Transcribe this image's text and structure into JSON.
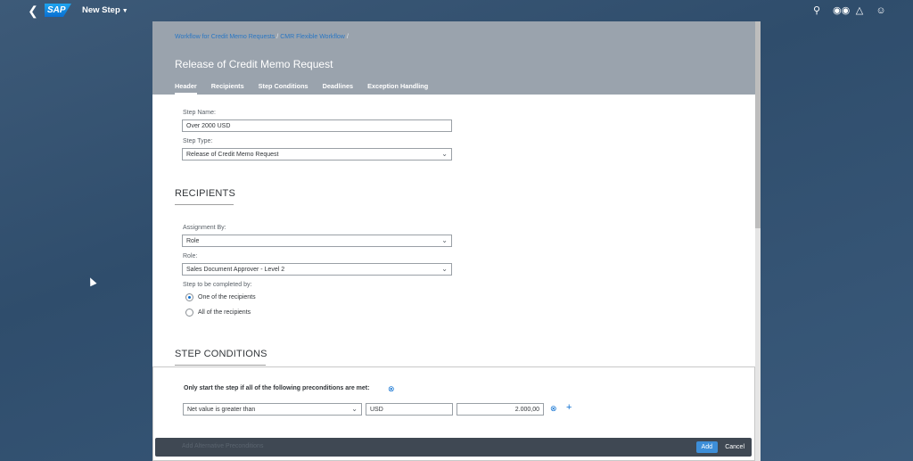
{
  "shell": {
    "app_title": "New Step",
    "logo_text": "SAP",
    "icons": [
      "search-icon",
      "binoculars-icon",
      "bell-icon",
      "user-icon"
    ]
  },
  "header": {
    "breadcrumb": [
      "Workflow for Credit Memo Requests",
      "CMR Flexible Workflow"
    ],
    "breadcrumb_separator": "/",
    "title": "Release of Credit Memo Request",
    "tabs": [
      "Header",
      "Recipients",
      "Step Conditions",
      "Deadlines",
      "Exception Handling"
    ]
  },
  "form": {
    "step_name_label": "Step Name:",
    "step_name_value": "Over 2000 USD",
    "step_type_label": "Step Type:",
    "step_type_value": "Release of Credit Memo Request"
  },
  "recipients": {
    "title": "RECIPIENTS",
    "assignment_label": "Assignment By:",
    "assignment_value": "Role",
    "role_label": "Role:",
    "role_value": "Sales Document Approver - Level 2",
    "completion_label": "Step to be completed by:",
    "options": [
      "One of the recipients",
      "All of the recipients"
    ],
    "selected_option": "One of the recipients"
  },
  "conditions": {
    "title": "STEP CONDITIONS",
    "heading": "Only start the step if all of the following preconditions are met:",
    "condition_value": "Net value is greater than",
    "currency_value": "USD",
    "amount_value": "2.000,00"
  },
  "footer": {
    "ghost_text": "Add Alternative Preconditions",
    "add_label": "Add",
    "cancel_label": "Cancel"
  },
  "colors": {
    "accent": "#0a6ed1",
    "header_bg": "#9aa3ad",
    "footer_bg": "#3f4853"
  }
}
